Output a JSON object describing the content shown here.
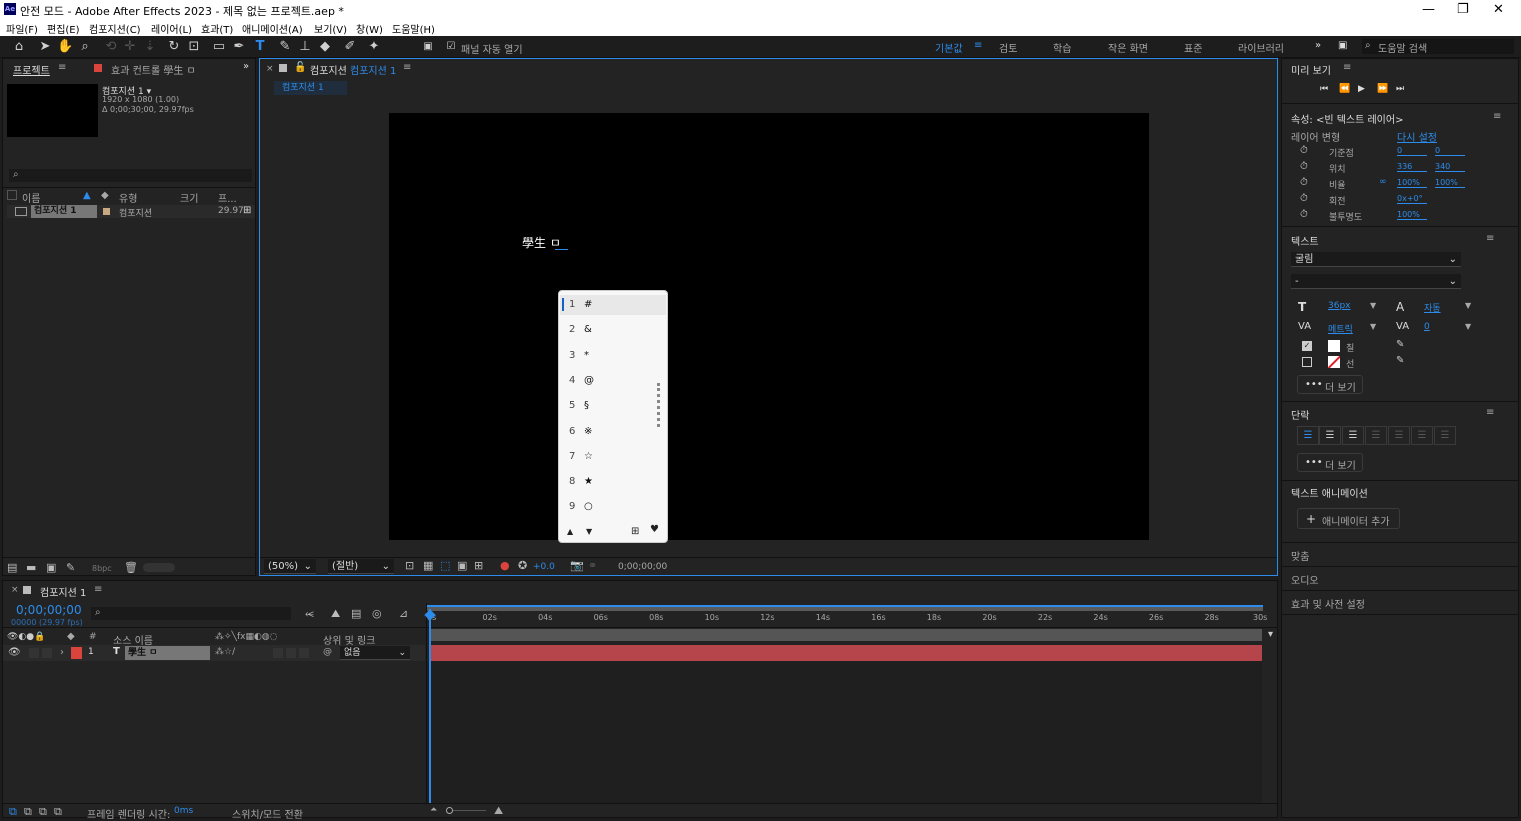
{
  "app": {
    "title": "안전 모드 - Adobe After Effects 2023 - 제목 없는 프로젝트.aep *",
    "logo": "Ae"
  },
  "menu": [
    "파일(F)",
    "편집(E)",
    "컴포지션(C)",
    "레이어(L)",
    "효과(T)",
    "애니메이션(A)",
    "보기(V)",
    "창(W)",
    "도움말(H)"
  ],
  "toolbar": {
    "panel_auto_open": "패널 자동 열기",
    "search_placeholder": "도움말 검색"
  },
  "workspaces": [
    "기본값",
    "검토",
    "학습",
    "작은 화면",
    "표준",
    "라이브러리"
  ],
  "project": {
    "tab": "프로젝트",
    "tab2": "효과 컨트롤 學生 ㅁ",
    "comp_name": "컴포지션 1 ▾",
    "comp_size": "1920 x 1080 (1.00)",
    "comp_dur": "Δ 0;00;30;00, 29.97fps",
    "columns": {
      "name": "이름",
      "type": "유형",
      "size": "크기",
      "fr": "프..."
    },
    "row": {
      "name": "컴포지션 1",
      "type": "컴포지션",
      "fps": "29.97"
    },
    "bpc": "8bpc"
  },
  "comp": {
    "tab_prefix": "컴포지션",
    "tab_name": "컴포지션 1",
    "breadcrumb": "컴포지션 1",
    "text": "學生 ㅁ",
    "zoom": "(50%)",
    "resolution": "(절반)",
    "exposure": "+0.0",
    "timecode": "0;00;00;00"
  },
  "ime": {
    "items": [
      {
        "n": "1",
        "c": "#"
      },
      {
        "n": "2",
        "c": "&"
      },
      {
        "n": "3",
        "c": "*"
      },
      {
        "n": "4",
        "c": "@"
      },
      {
        "n": "5",
        "c": "§"
      },
      {
        "n": "6",
        "c": "※"
      },
      {
        "n": "7",
        "c": "☆"
      },
      {
        "n": "8",
        "c": "★"
      },
      {
        "n": "9",
        "c": "○"
      }
    ]
  },
  "preview": {
    "title": "미리 보기"
  },
  "props": {
    "title": "속성: <빈 텍스트 레이어>",
    "transform": "레이어 변형",
    "reset": "다시 설정",
    "rows": [
      {
        "label": "기준점",
        "v1": "0",
        "v2": "0"
      },
      {
        "label": "위치",
        "v1": "336",
        "v2": "340"
      },
      {
        "label": "비율",
        "v1": "100%",
        "v2": "100%"
      },
      {
        "label": "회전",
        "v1": "0x+0°",
        "v2": ""
      },
      {
        "label": "불투명도",
        "v1": "100%",
        "v2": ""
      }
    ],
    "text_section": "텍스트",
    "font": "굴림",
    "style": "-",
    "size": "36px",
    "leading": "자동",
    "kern": "메트릭",
    "track": "0",
    "fill": "칠",
    "stroke": "선",
    "more": "더 보기",
    "para": "단락",
    "more2": "더 보기",
    "anim": "텍스트 애니메이션",
    "anim_add": "애니메이터 추가",
    "align": "맞춤",
    "audio": "오디오",
    "effects": "효과 및 사전 설정"
  },
  "timeline": {
    "tab": "컴포지션 1",
    "timecode": "0;00;00;00",
    "timecode_sub": "00000 (29.97 fps)",
    "cols": {
      "num": "#",
      "name": "소스 이름",
      "parent": "상위 및 링크"
    },
    "layer": {
      "num": "1",
      "type": "T",
      "name": "學生 ㅁ",
      "parent": "없음"
    },
    "ruler": [
      "0s",
      "02s",
      "04s",
      "06s",
      "08s",
      "10s",
      "12s",
      "14s",
      "16s",
      "18s",
      "20s",
      "22s",
      "24s",
      "26s",
      "28s",
      "30s"
    ],
    "render_label": "프레임 렌더링 시간:",
    "render_val": "0ms",
    "switch_mode": "스위치/모드 전환"
  },
  "colors": {
    "accent": "#2d8ceb",
    "layer_bar": "#b5454a",
    "label_red": "#d9453d"
  }
}
